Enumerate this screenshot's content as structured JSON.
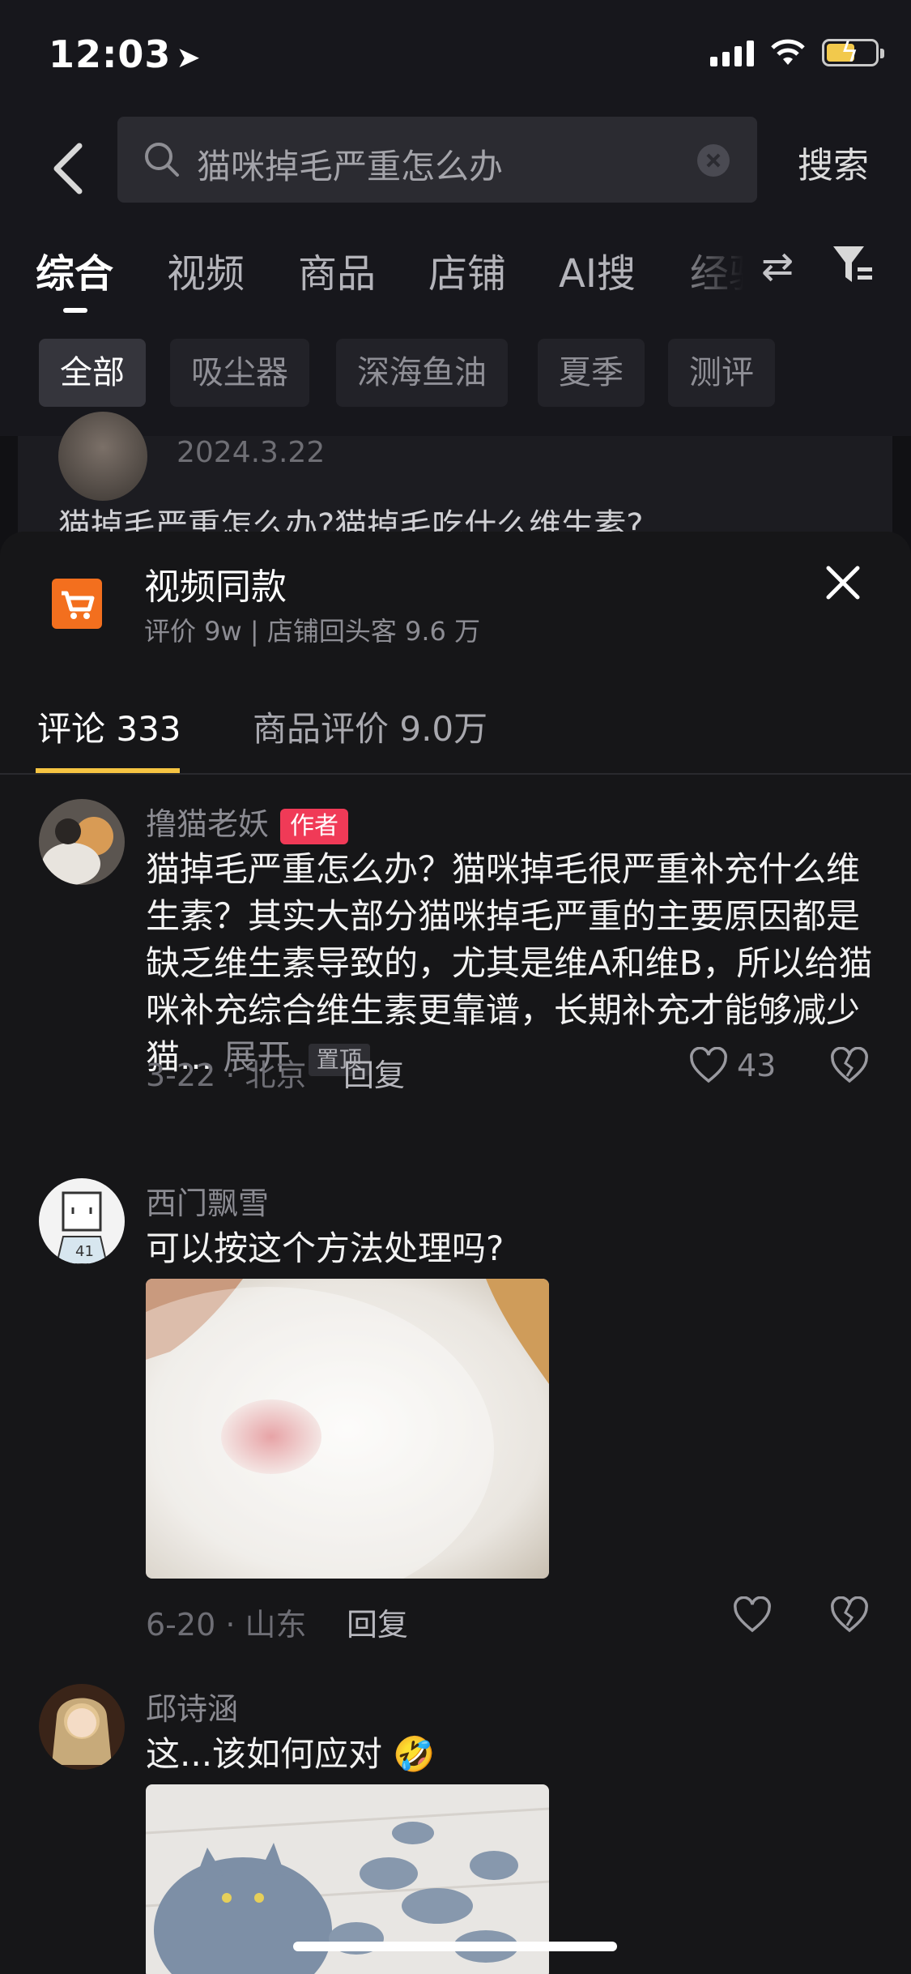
{
  "status_bar": {
    "time": "12:03"
  },
  "search": {
    "query": "猫咪掉毛严重怎么办",
    "button": "搜索"
  },
  "tabs": [
    "综合",
    "视频",
    "商品",
    "店铺",
    "AI搜",
    "经验"
  ],
  "chips": [
    "全部",
    "吸尘器",
    "深海鱼油",
    "夏季",
    "测评"
  ],
  "background_card": {
    "date": "2024.3.22",
    "title": "猫掉毛严重怎么办?猫掉毛吃什么维生素?"
  },
  "sheet": {
    "title": "视频同款",
    "subtitle": "评价 9w | 店铺回头客 9.6 万",
    "tab_comments": "评论 333",
    "tab_reviews": "商品评价 9.0万"
  },
  "comments": [
    {
      "name": "撸猫老妖",
      "badge": "作者",
      "text": "猫掉毛严重怎么办？猫咪掉毛很严重补充什么维生素？其实大部分猫咪掉毛严重的主要原因都是缺乏维生素导致的，尤其是维A和维B，所以给猫咪补充综合维生素更靠谱，长期补充才能够减少猫...",
      "expand": "展开",
      "pin": "置顶",
      "meta": "3-22 · 北京",
      "reply": "回复",
      "likes": "43"
    },
    {
      "name": "西门飘雪",
      "text": "可以按这个方法处理吗?",
      "meta": "6-20 · 山东",
      "reply": "回复"
    },
    {
      "name": "邱诗涵",
      "text": "这...该如何应对",
      "emoji": "🤣"
    }
  ],
  "colors": {
    "accent": "#f5c442",
    "badge": "#f03a57",
    "cart": "#f36f1e"
  }
}
